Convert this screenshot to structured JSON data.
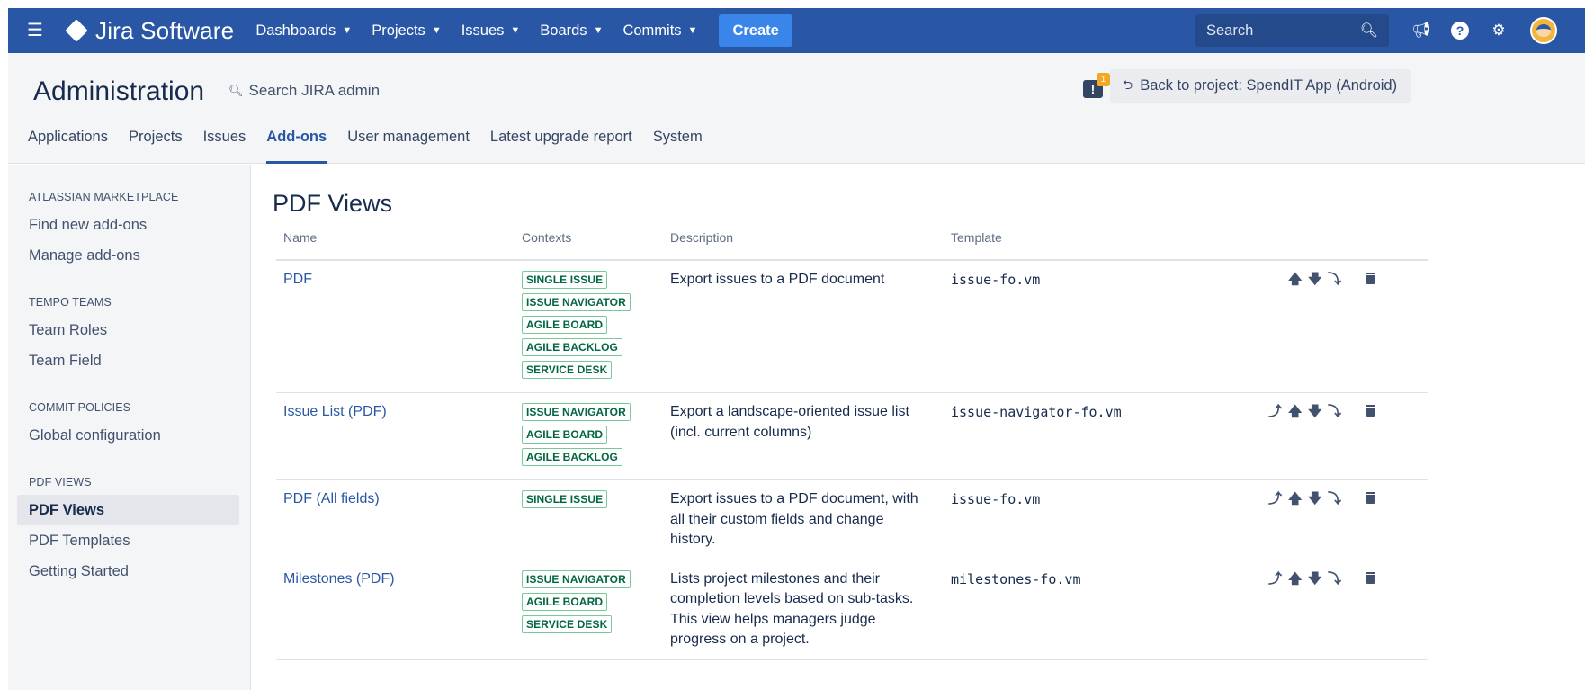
{
  "topnav": {
    "product": "Jira Software",
    "menus": [
      {
        "label": "Dashboards"
      },
      {
        "label": "Projects"
      },
      {
        "label": "Issues"
      },
      {
        "label": "Boards"
      },
      {
        "label": "Commits"
      }
    ],
    "create_label": "Create",
    "search_placeholder": "Search",
    "icons": [
      "megaphone-icon",
      "help-icon",
      "settings-gear-icon",
      "user-avatar"
    ],
    "brand_color": "#2a57a5",
    "create_color": "#3a85ea"
  },
  "admin": {
    "title": "Administration",
    "search_label": "Search JIRA admin",
    "feedback_badge": "1",
    "back_button": "Back to project: SpendIT App (Android)",
    "tabs": [
      {
        "label": "Applications"
      },
      {
        "label": "Projects"
      },
      {
        "label": "Issues"
      },
      {
        "label": "Add-ons",
        "active": true
      },
      {
        "label": "User management"
      },
      {
        "label": "Latest upgrade report"
      },
      {
        "label": "System"
      }
    ]
  },
  "sidebar": {
    "sections": [
      {
        "heading": "ATLASSIAN MARKETPLACE",
        "items": [
          "Find new add-ons",
          "Manage add-ons"
        ]
      },
      {
        "heading": "TEMPO TEAMS",
        "items": [
          "Team Roles",
          "Team Field"
        ]
      },
      {
        "heading": "COMMIT POLICIES",
        "items": [
          "Global configuration"
        ]
      },
      {
        "heading": "PDF VIEWS",
        "items": [
          "PDF Views",
          "PDF Templates",
          "Getting Started"
        ],
        "active_item": "PDF Views"
      }
    ]
  },
  "main": {
    "title": "PDF Views",
    "columns": {
      "name": "Name",
      "contexts": "Contexts",
      "description": "Description",
      "template": "Template"
    },
    "rows": [
      {
        "name": "PDF",
        "contexts": [
          "SINGLE ISSUE",
          "ISSUE NAVIGATOR",
          "AGILE BOARD",
          "AGILE BACKLOG",
          "SERVICE DESK"
        ],
        "description": "Export issues to a PDF document",
        "template": "issue-fo.vm",
        "actions": [
          "move-up",
          "move-down",
          "move-bottom"
        ]
      },
      {
        "name": "Issue List (PDF)",
        "contexts": [
          "ISSUE NAVIGATOR",
          "AGILE BOARD",
          "AGILE BACKLOG"
        ],
        "description": "Export a landscape-oriented issue list (incl. current columns)",
        "template": "issue-navigator-fo.vm",
        "actions": [
          "move-top",
          "move-up",
          "move-down",
          "move-bottom"
        ]
      },
      {
        "name": "PDF (All fields)",
        "contexts": [
          "SINGLE ISSUE"
        ],
        "description": "Export issues to a PDF document, with all their custom fields and change history.",
        "template": "issue-fo.vm",
        "actions": [
          "move-top",
          "move-up",
          "move-down",
          "move-bottom"
        ]
      },
      {
        "name": "Milestones (PDF)",
        "contexts": [
          "ISSUE NAVIGATOR",
          "AGILE BOARD",
          "SERVICE DESK"
        ],
        "description": "Lists project milestones and their completion levels based on sub-tasks. This view helps managers judge progress on a project.",
        "template": "milestones-fo.vm",
        "actions": [
          "move-top",
          "move-up",
          "move-down",
          "move-bottom"
        ]
      }
    ]
  }
}
